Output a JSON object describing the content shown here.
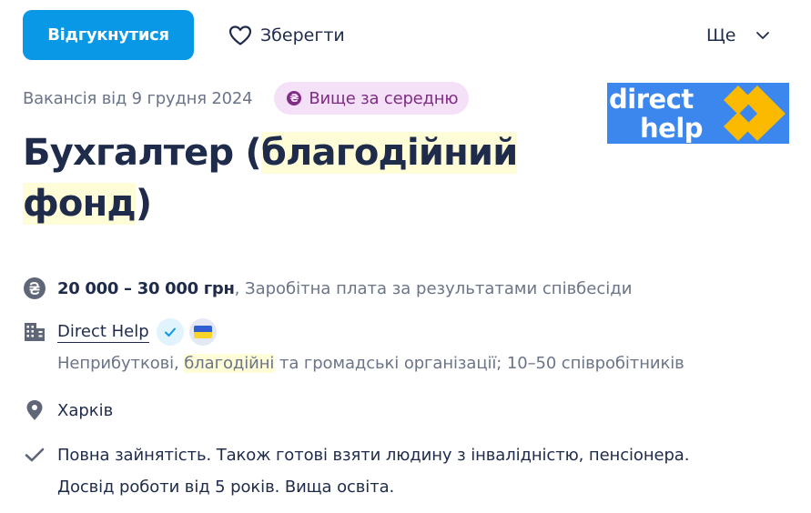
{
  "toolbar": {
    "apply_label": "Відгукнутися",
    "save_label": "Зберегти",
    "more_label": "Ще",
    "accent_color": "#0898e5"
  },
  "meta": {
    "posted": "Вакансія від 9 грудня 2024",
    "badge_icon": "₴",
    "badge_label": "Вище за середню"
  },
  "logo": {
    "line1": "direct",
    "line2": "help",
    "brand_bg": "#3b87ee",
    "brand_accent": "#fbb900"
  },
  "title": {
    "part1": "Бухгалтер (",
    "highlight1": "благодійний",
    "highlight2": "фонд",
    "part2": ")"
  },
  "details": {
    "salary_range": "20 000 – 30 000 грн",
    "salary_note": ", Заробітна плата за результатами співбесіди",
    "company_name": "Direct Help",
    "industry_prefix": "Неприбуткові, ",
    "industry_highlight": "благодійні",
    "industry_suffix": " та громадські організації; 10–50 співробітників",
    "city": "Харків",
    "terms_line1": "Повна зайнятість. Також готові взяти людину з інвалідністю, пенсіонера.",
    "terms_line2": "Досвід роботи від 5 років. Вища освіта."
  },
  "icons": {
    "save": "heart-icon",
    "more": "chevron-down-icon",
    "salary": "hryvnia-icon",
    "company": "building-icon",
    "verified": "check-icon",
    "flag": "ukraine-flag-icon",
    "city": "location-pin-icon",
    "terms": "check-icon"
  }
}
